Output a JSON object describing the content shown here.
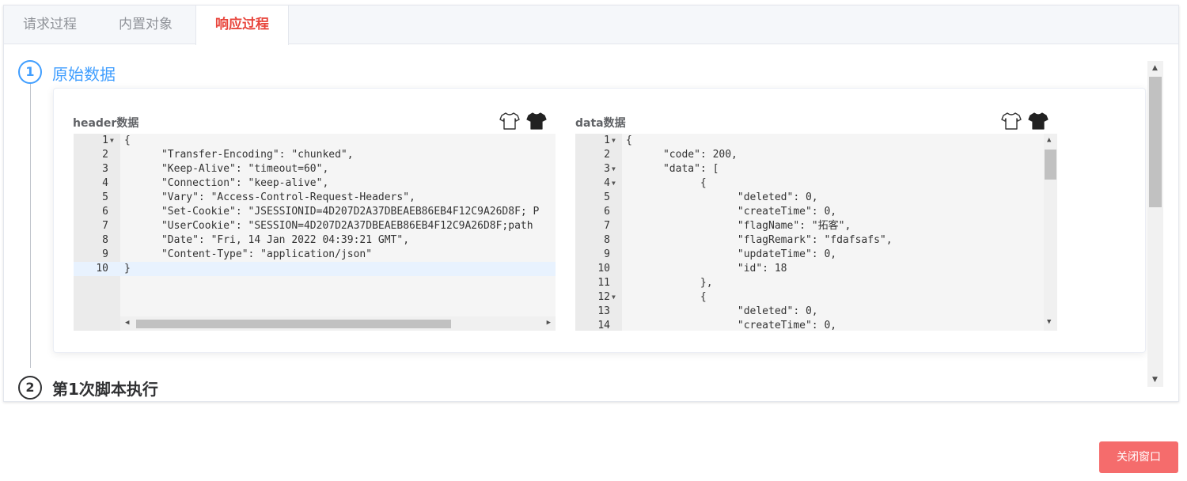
{
  "tabs": [
    {
      "label": "请求过程",
      "active": false
    },
    {
      "label": "内置对象",
      "active": false
    },
    {
      "label": "响应过程",
      "active": true
    }
  ],
  "steps": [
    {
      "number": "1",
      "title": "原始数据"
    },
    {
      "number": "2",
      "title": "第1次脚本执行"
    }
  ],
  "header_block": {
    "label": "header数据",
    "lines": [
      {
        "n": "1",
        "fold": true,
        "text": "{"
      },
      {
        "n": "2",
        "text": "      \"Transfer-Encoding\": \"chunked\","
      },
      {
        "n": "3",
        "text": "      \"Keep-Alive\": \"timeout=60\","
      },
      {
        "n": "4",
        "text": "      \"Connection\": \"keep-alive\","
      },
      {
        "n": "5",
        "text": "      \"Vary\": \"Access-Control-Request-Headers\","
      },
      {
        "n": "6",
        "text": "      \"Set-Cookie\": \"JSESSIONID=4D207D2A37DBEAEB86EB4F12C9A26D8F; P"
      },
      {
        "n": "7",
        "text": "      \"UserCookie\": \"SESSION=4D207D2A37DBEAEB86EB4F12C9A26D8F;path"
      },
      {
        "n": "8",
        "text": "      \"Date\": \"Fri, 14 Jan 2022 04:39:21 GMT\","
      },
      {
        "n": "9",
        "text": "      \"Content-Type\": \"application/json\""
      },
      {
        "n": "10",
        "text": "}",
        "highlight": true
      }
    ]
  },
  "data_block": {
    "label": "data数据",
    "lines": [
      {
        "n": "1",
        "fold": true,
        "text": "{"
      },
      {
        "n": "2",
        "text": "      \"code\": 200,"
      },
      {
        "n": "3",
        "fold": true,
        "text": "      \"data\": ["
      },
      {
        "n": "4",
        "fold": true,
        "text": "            {"
      },
      {
        "n": "5",
        "text": "                  \"deleted\": 0,"
      },
      {
        "n": "6",
        "text": "                  \"createTime\": 0,"
      },
      {
        "n": "7",
        "text": "                  \"flagName\": \"拓客\","
      },
      {
        "n": "8",
        "text": "                  \"flagRemark\": \"fdafsafs\","
      },
      {
        "n": "9",
        "text": "                  \"updateTime\": 0,"
      },
      {
        "n": "10",
        "text": "                  \"id\": 18"
      },
      {
        "n": "11",
        "text": "            },"
      },
      {
        "n": "12",
        "fold": true,
        "text": "            {"
      },
      {
        "n": "13",
        "text": "                  \"deleted\": 0,"
      },
      {
        "n": "14",
        "text": "                  \"createTime\": 0,"
      }
    ]
  },
  "close_button": {
    "label": "关闭窗口"
  },
  "colors": {
    "accent": "#409eff",
    "active_tab": "#e8453c",
    "close_button": "#f56c6c"
  },
  "icons": {
    "light_shirt": "tshirt-outline-icon",
    "dark_shirt": "tshirt-filled-icon"
  }
}
